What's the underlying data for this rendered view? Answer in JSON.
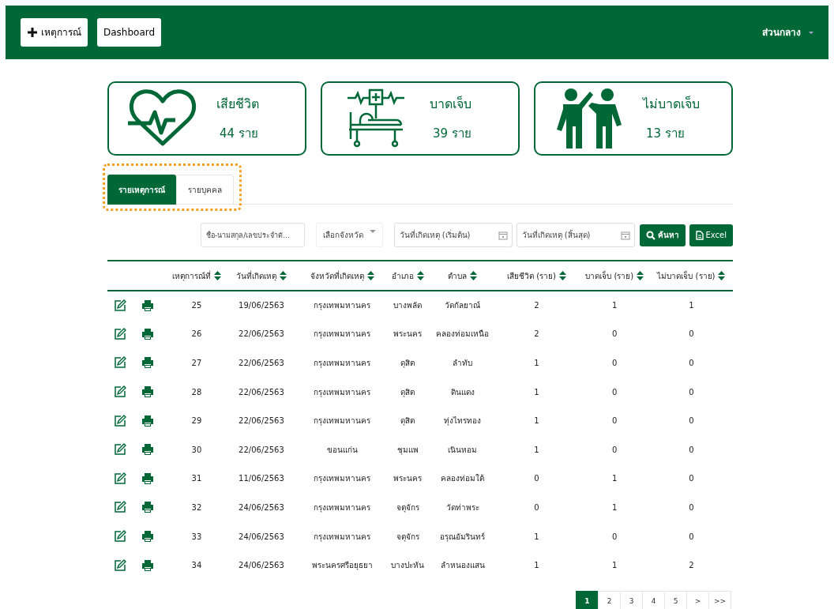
{
  "header": {
    "add_button": "เหตุการณ์",
    "dashboard_button": "Dashboard",
    "user_menu": "ส่วนกลาง"
  },
  "summary_cards": [
    {
      "kind": "heart",
      "title": "เสียชีวิต",
      "count": "44 ราย"
    },
    {
      "kind": "bed",
      "title": "บาดเจ็บ",
      "count": "39 ราย"
    },
    {
      "kind": "people",
      "title": "ไม่บาดเจ็บ",
      "count": "13 ราย"
    }
  ],
  "tabs": [
    {
      "label": "รายเหตุการณ์",
      "selected": true
    },
    {
      "label": "รายบุคคล",
      "selected": false
    }
  ],
  "filters": {
    "search": {
      "placeholder": "ชื่อ-นามสกุล/เลขประจำตั..."
    },
    "province": "เลือกจังหวัด",
    "date_start": {
      "placeholder": "วันที่เกิดเหตุ (เริ่มต้น)"
    },
    "date_end": {
      "placeholder": "วันที่เกิดเหตุ (สิ้นสุด)"
    },
    "search_button": "ค้นหา",
    "excel_button": "Excel"
  },
  "table": {
    "columns": [
      "เหตุการณ์ที่",
      "วันที่เกิดเหตุ",
      "จังหวัดที่เกิดเหตุ",
      "อำเภอ",
      "ตำบล",
      "เสียชีวิต (ราย)",
      "บาดเจ็บ (ราย)",
      "ไม่บาดเจ็บ (ราย)"
    ],
    "rows": [
      [
        "25",
        "19/06/2563",
        "กรุงเทพมหานคร",
        "บางพลัด",
        "วัดกัลยาณ์",
        "2",
        "1",
        "1"
      ],
      [
        "26",
        "22/06/2563",
        "กรุงเทพมหานคร",
        "พระนคร",
        "คลองท่อมเหนือ",
        "2",
        "0",
        "0"
      ],
      [
        "27",
        "22/06/2563",
        "กรุงเทพมหานคร",
        "ดุสิต",
        "ลำทับ",
        "1",
        "0",
        "0"
      ],
      [
        "28",
        "22/06/2563",
        "กรุงเทพมหานคร",
        "ดุสิต",
        "ดินแดง",
        "1",
        "0",
        "0"
      ],
      [
        "29",
        "22/06/2563",
        "กรุงเทพมหานคร",
        "ดุสิต",
        "ทุ่งไทรทอง",
        "1",
        "0",
        "0"
      ],
      [
        "30",
        "22/06/2563",
        "ขอนแก่น",
        "ชุมแพ",
        "เนินหอม",
        "1",
        "0",
        "0"
      ],
      [
        "31",
        "11/06/2563",
        "กรุงเทพมหานคร",
        "พระนคร",
        "คลองท่อมใต้",
        "0",
        "1",
        "0"
      ],
      [
        "32",
        "24/06/2563",
        "กรุงเทพมหานคร",
        "จตุจักร",
        "วัดท่าพระ",
        "0",
        "1",
        "0"
      ],
      [
        "33",
        "24/06/2563",
        "กรุงเทพมหานคร",
        "จตุจักร",
        "อรุณอัมรินทร์",
        "1",
        "0",
        "0"
      ],
      [
        "34",
        "24/06/2563",
        "พระนครศรีอยุธยา",
        "บางปะหัน",
        "ลำหนองแสน",
        "1",
        "1",
        "2"
      ]
    ]
  },
  "pagination": [
    {
      "label": "1",
      "selected": true
    },
    {
      "label": "2",
      "selected": false
    },
    {
      "label": "3",
      "selected": false
    },
    {
      "label": "4",
      "selected": false
    },
    {
      "label": "5",
      "selected": false
    },
    {
      "label": ">",
      "selected": false
    },
    {
      "label": ">>",
      "selected": false
    }
  ]
}
